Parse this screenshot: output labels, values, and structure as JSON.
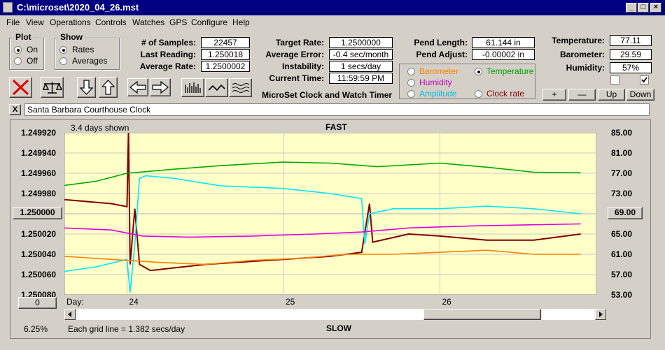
{
  "window": {
    "title": "C:\\microset\\2020_04_26.mst"
  },
  "menu": [
    "File",
    "View",
    "Operations",
    "Controls",
    "Watches",
    "GPS",
    "Configure",
    "Help"
  ],
  "plot_group": {
    "title": "Plot",
    "on_label": "On",
    "off_label": "Off",
    "selected": "On"
  },
  "show_group": {
    "title": "Show",
    "rates_label": "Rates",
    "averages_label": "Averages",
    "selected": "Rates"
  },
  "stats": {
    "samples_label": "# of Samples:",
    "samples_value": "22457",
    "last_reading_label": "Last Reading:",
    "last_reading_value": "1.250018",
    "average_rate_label": "Average Rate:",
    "average_rate_value": "1.2500002"
  },
  "targets": {
    "target_rate_label": "Target Rate:",
    "target_rate_value": "1.2500000",
    "average_error_label": "Average Error:",
    "average_error_value": "-0.4 sec/month",
    "instability_label": "Instability:",
    "instability_value": "1 secs/day",
    "current_time_label": "Current Time:",
    "current_time_value": "11:59:59 PM",
    "app_caption": "MicroSet Clock and Watch Timer"
  },
  "pendulum": {
    "length_label": "Pend Length:",
    "length_value": "61.144 in",
    "adjust_label": "Pend Adjust:",
    "adjust_value": "-0.00002 in"
  },
  "overlay": {
    "barometer": "Barometer",
    "temperature": "Temperature",
    "humidity": "Humidity",
    "amplitude": "Amplitude",
    "clock_rate": "Clock rate",
    "selected": "Temperature"
  },
  "environment": {
    "temperature_label": "Temperature:",
    "temperature_value": "77.11",
    "barometer_label": "Barometer:",
    "barometer_value": "29.59",
    "humidity_label": "Humidity:",
    "humidity_value": "57%"
  },
  "scale_buttons": {
    "plus": "+",
    "minus": "—",
    "up": "Up",
    "down": "Down"
  },
  "clock_name": "Santa Barbara Courthouse Clock",
  "close_symbol": "X",
  "plot": {
    "days_shown": "3.4 days shown",
    "fast_label": "FAST",
    "slow_label": "SLOW",
    "grid_note": "Each grid line = 1.382 secs/day",
    "percent": "6.25%",
    "left_center_button": "1.250000",
    "right_center_button": "69.00",
    "bottom_left_button": "0",
    "day_label": "Day:"
  },
  "chart_data": {
    "type": "line",
    "y_left_ticks": [
      "1.249920",
      "1.249940",
      "1.249960",
      "1.249980",
      "1.250000",
      "1.250020",
      "1.250040",
      "1.250060",
      "1.250080"
    ],
    "y_right_ticks": [
      "85.00",
      "81.00",
      "77.00",
      "73.00",
      "69.00",
      "65.00",
      "61.00",
      "57.00",
      "53.00"
    ],
    "y_left_range": [
      1.24992,
      1.25008
    ],
    "y_right_range": [
      53,
      85
    ],
    "x_range": [
      23.6,
      27.0
    ],
    "x_ticks": [
      "24",
      "25",
      "26"
    ],
    "x_tick_values": [
      24,
      25,
      26
    ],
    "series": [
      {
        "key": "clock_rate",
        "color": "#800000",
        "axis": "left",
        "points": [
          [
            23.6,
            1.249986
          ],
          [
            23.9,
            1.24999
          ],
          [
            24.0,
            1.249993
          ],
          [
            24.01,
            1.24992
          ],
          [
            24.02,
            1.25005
          ],
          [
            24.05,
            1.249995
          ],
          [
            24.08,
            1.25005
          ],
          [
            24.15,
            1.250056
          ],
          [
            24.5,
            1.25005
          ],
          [
            24.9,
            1.250046
          ],
          [
            25.3,
            1.250042
          ],
          [
            25.5,
            1.250038
          ],
          [
            25.55,
            1.24999
          ],
          [
            25.57,
            1.250028
          ],
          [
            25.8,
            1.25002
          ],
          [
            26.0,
            1.250022
          ],
          [
            26.3,
            1.250026
          ],
          [
            26.6,
            1.250026
          ],
          [
            26.9,
            1.25002
          ]
        ]
      },
      {
        "key": "temperature",
        "color": "#00aa00",
        "axis": "right",
        "points": [
          [
            23.6,
            74.6
          ],
          [
            23.8,
            75.4
          ],
          [
            24.0,
            77.0
          ],
          [
            24.3,
            77.8
          ],
          [
            24.6,
            78.5
          ],
          [
            25.0,
            79.2
          ],
          [
            25.3,
            79.0
          ],
          [
            25.6,
            78.3
          ],
          [
            26.0,
            79.0
          ],
          [
            26.3,
            78.2
          ],
          [
            26.6,
            77.2
          ],
          [
            26.9,
            77.1
          ]
        ]
      },
      {
        "key": "humidity",
        "color": "#00e8ff",
        "axis": "right",
        "points": [
          [
            23.6,
            57.6
          ],
          [
            23.8,
            58.5
          ],
          [
            24.0,
            60.0
          ],
          [
            24.02,
            53.5
          ],
          [
            24.05,
            63.0
          ],
          [
            24.08,
            76.0
          ],
          [
            24.12,
            76.5
          ],
          [
            24.3,
            76.0
          ],
          [
            24.6,
            74.5
          ],
          [
            25.0,
            74.0
          ],
          [
            25.3,
            73.0
          ],
          [
            25.5,
            72.0
          ],
          [
            25.52,
            63.0
          ],
          [
            25.55,
            69.0
          ],
          [
            25.7,
            70.0
          ],
          [
            26.0,
            70.0
          ],
          [
            26.3,
            70.5
          ],
          [
            26.6,
            70.0
          ],
          [
            26.9,
            69.0
          ]
        ]
      },
      {
        "key": "amplitude",
        "color": "#e000e0",
        "axis": "left",
        "points": [
          [
            23.6,
            1.250014
          ],
          [
            23.9,
            1.250016
          ],
          [
            24.1,
            1.250022
          ],
          [
            24.4,
            1.250023
          ],
          [
            24.8,
            1.250022
          ],
          [
            25.2,
            1.25002
          ],
          [
            25.5,
            1.250018
          ],
          [
            25.8,
            1.250014
          ],
          [
            26.2,
            1.250012
          ],
          [
            26.9,
            1.25001
          ]
        ]
      },
      {
        "key": "barometer",
        "color": "#ff8000",
        "axis": "left",
        "points": [
          [
            23.6,
            1.250042
          ],
          [
            23.9,
            1.250045
          ],
          [
            24.0,
            1.250046
          ],
          [
            24.2,
            1.250048
          ],
          [
            24.5,
            1.25005
          ],
          [
            24.8,
            1.250046
          ],
          [
            25.1,
            1.250044
          ],
          [
            25.4,
            1.25004
          ],
          [
            25.7,
            1.25004
          ],
          [
            26.0,
            1.250038
          ],
          [
            26.3,
            1.250036
          ],
          [
            26.6,
            1.25004
          ],
          [
            26.9,
            1.25004
          ]
        ]
      }
    ]
  }
}
